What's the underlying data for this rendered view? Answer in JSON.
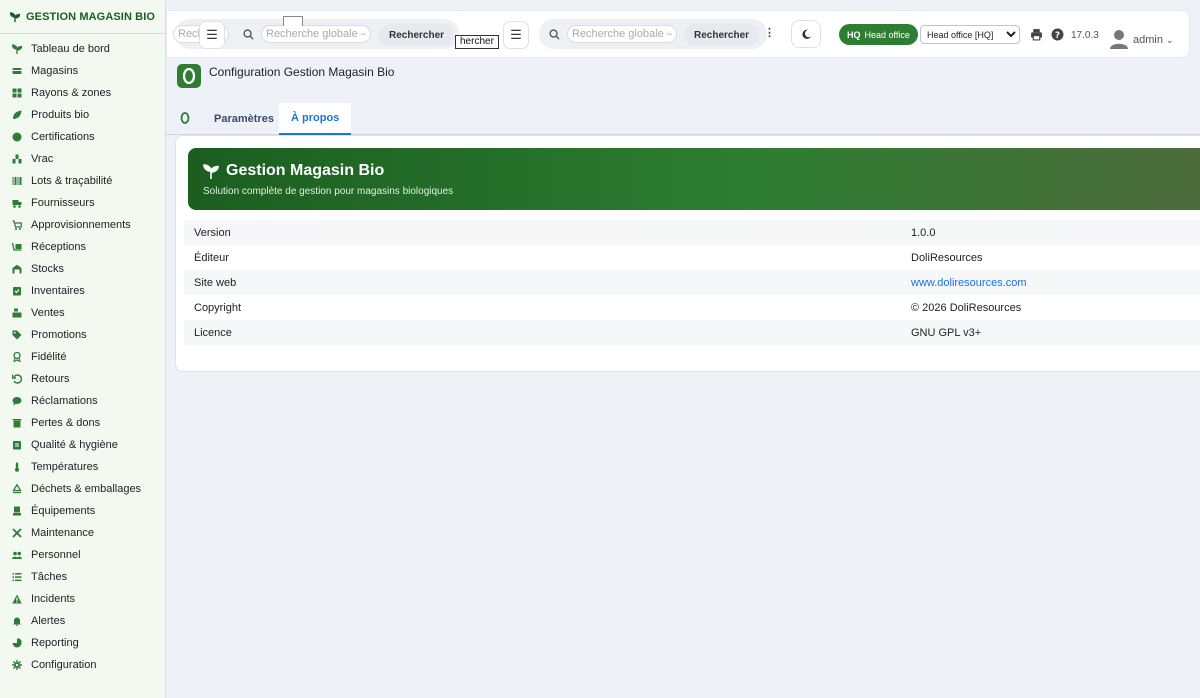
{
  "sidebar": {
    "brand": "GESTION MAGASIN BIO",
    "items": [
      {
        "label": "Tableau de bord",
        "icon": "seedling-icon"
      },
      {
        "label": "Magasins",
        "icon": "store-icon"
      },
      {
        "label": "Rayons & zones",
        "icon": "grid-icon"
      },
      {
        "label": "Produits bio",
        "icon": "leaf-icon"
      },
      {
        "label": "Certifications",
        "icon": "certificate-icon"
      },
      {
        "label": "Vrac",
        "icon": "bulk-icon"
      },
      {
        "label": "Lots & traçabilité",
        "icon": "barcode-icon"
      },
      {
        "label": "Fournisseurs",
        "icon": "truck-icon"
      },
      {
        "label": "Approvisionnements",
        "icon": "cart-icon"
      },
      {
        "label": "Réceptions",
        "icon": "dolly-icon"
      },
      {
        "label": "Stocks",
        "icon": "warehouse-icon"
      },
      {
        "label": "Inventaires",
        "icon": "clipboard-check-icon"
      },
      {
        "label": "Ventes",
        "icon": "cash-register-icon"
      },
      {
        "label": "Promotions",
        "icon": "tags-icon"
      },
      {
        "label": "Fidélité",
        "icon": "award-icon"
      },
      {
        "label": "Retours",
        "icon": "undo-icon"
      },
      {
        "label": "Réclamations",
        "icon": "comment-icon"
      },
      {
        "label": "Pertes & dons",
        "icon": "trash-icon"
      },
      {
        "label": "Qualité & hygiène",
        "icon": "clipboard-icon"
      },
      {
        "label": "Températures",
        "icon": "thermometer-icon"
      },
      {
        "label": "Déchets & emballages",
        "icon": "recycle-icon"
      },
      {
        "label": "Équipements",
        "icon": "blender-icon"
      },
      {
        "label": "Maintenance",
        "icon": "tools-icon"
      },
      {
        "label": "Personnel",
        "icon": "users-icon"
      },
      {
        "label": "Tâches",
        "icon": "list-icon"
      },
      {
        "label": "Incidents",
        "icon": "warning-icon"
      },
      {
        "label": "Alertes",
        "icon": "bell-icon"
      },
      {
        "label": "Reporting",
        "icon": "pie-chart-icon"
      },
      {
        "label": "Configuration",
        "icon": "gear-icon"
      }
    ]
  },
  "topbar": {
    "search_placeholder_clipped": "Reche",
    "search_placeholder": "Recherche globale — ci",
    "search_button": "Rechercher",
    "tooltip_text": "hercher",
    "hq_code": "HQ",
    "hq_label": "Head office",
    "site_selected": "Head office [HQ]",
    "version": "17.0.3",
    "user": "admin"
  },
  "page": {
    "title": "Configuration Gestion Magasin Bio"
  },
  "tabs": [
    {
      "label": "Paramètres",
      "active": false
    },
    {
      "label": "À propos",
      "active": true
    }
  ],
  "hero": {
    "title": "Gestion Magasin Bio",
    "subtitle": "Solution complète de gestion pour magasins biologiques"
  },
  "info": {
    "rows": [
      {
        "label": "Version",
        "value": "1.0.0"
      },
      {
        "label": "Éditeur",
        "value": "DoliResources"
      },
      {
        "label": "Site web",
        "value": "www.doliresources.com"
      },
      {
        "label": "Copyright",
        "value": "© 2026 DoliResources"
      },
      {
        "label": "Licence",
        "value": "GNU GPL v3+"
      }
    ]
  },
  "colors": {
    "brand_green": "#2e7d32",
    "dark_green": "#1b5e20",
    "link_blue": "#1a73e8",
    "active_tab_blue": "#1976d2"
  }
}
